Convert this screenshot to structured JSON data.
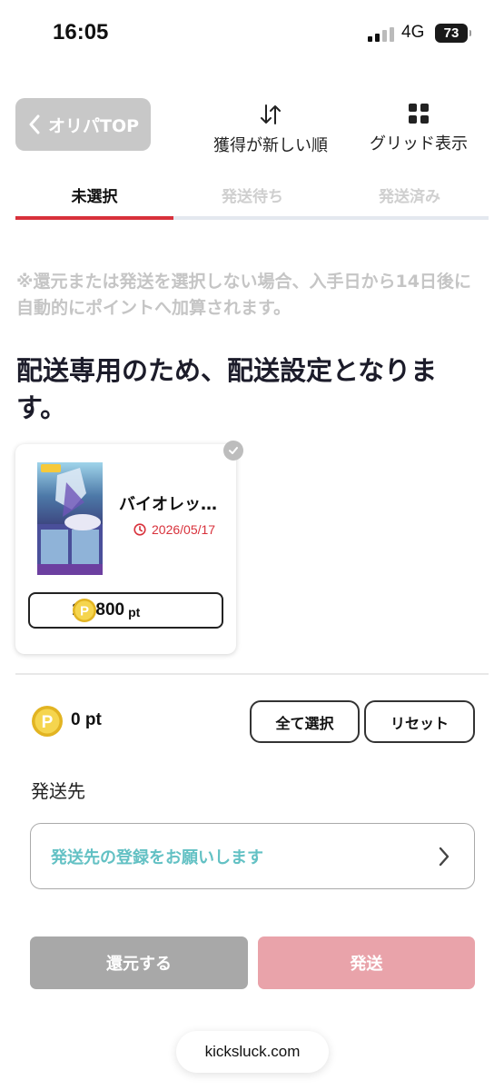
{
  "status_bar": {
    "time": "16:05",
    "network": "4G",
    "battery": "73"
  },
  "header": {
    "back_label": "オリパTOP",
    "sort_label": "獲得が新しい順",
    "grid_label": "グリッド表示"
  },
  "tabs": [
    {
      "label": "未選択",
      "active": true
    },
    {
      "label": "発送待ち",
      "active": false
    },
    {
      "label": "発送済み",
      "active": false
    }
  ],
  "notice": "※還元または発送を選択しない場合、入手日から14日後に自動的にポイントへ加算されます。",
  "heading": "配送専用のため、配送設定となります。",
  "card": {
    "name": "バイオレッ…",
    "expire_date": "2026/05/17",
    "price": "14,800",
    "price_unit": "pt",
    "image_icon": "pokemon-booster-box-image"
  },
  "points": {
    "value": "0",
    "unit": "pt"
  },
  "actions": {
    "select_all": "全て選択",
    "reset": "リセット"
  },
  "shipping": {
    "label": "発送先",
    "placeholder": "発送先の登録をお願いします"
  },
  "buttons": {
    "return": "還元する",
    "send": "発送"
  },
  "browser": {
    "url": "kicksluck.com"
  },
  "colors": {
    "accent_red": "#d8313b",
    "send_disabled": "#e9a3aa",
    "return_gray": "#a8a8a8",
    "address_teal": "#63c1c4"
  }
}
